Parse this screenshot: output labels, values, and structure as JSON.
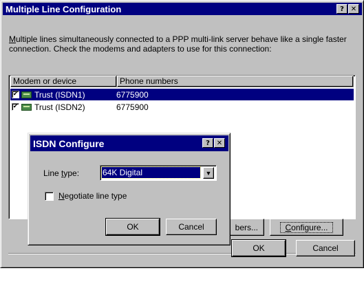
{
  "main_dialog": {
    "title": "Multiple Line Configuration",
    "help_button": "?",
    "close_button": "✕",
    "description_prefix": "",
    "description_mnemonic": "M",
    "description_rest": "ultiple lines simultaneously connected to a PPP multi-link server behave like a single faster connection.  Check the modems and adapters to use for this connection:",
    "columns": [
      "Modem or device",
      "Phone numbers"
    ],
    "rows": [
      {
        "checked": true,
        "device": "Trust (ISDN1)",
        "phone": "6775900",
        "selected": true
      },
      {
        "checked": true,
        "device": "Trust (ISDN2)",
        "phone": "6775900",
        "selected": false
      }
    ],
    "numbers_button_visible": "bers...",
    "configure_button": {
      "mnemonic": "C",
      "rest": "onfigure..."
    },
    "ok_button": "OK",
    "cancel_button": "Cancel"
  },
  "isdn_dialog": {
    "title": "ISDN Configure",
    "help_button": "?",
    "close_button": "✕",
    "line_type_label": {
      "before": "Line ",
      "mnemonic": "t",
      "after": "ype:"
    },
    "line_type_value": "64K Digital",
    "negotiate_checkbox": {
      "checked": false,
      "mnemonic": "N",
      "rest": "egotiate line type"
    },
    "ok_button": "OK",
    "cancel_button": "Cancel"
  },
  "icons": {
    "checkmark": "✔",
    "dropdown_arrow": "▼",
    "modem": "modem-icon"
  },
  "colors": {
    "titlebar": "#000080",
    "face": "#c0c0c0",
    "selection": "#000080"
  }
}
